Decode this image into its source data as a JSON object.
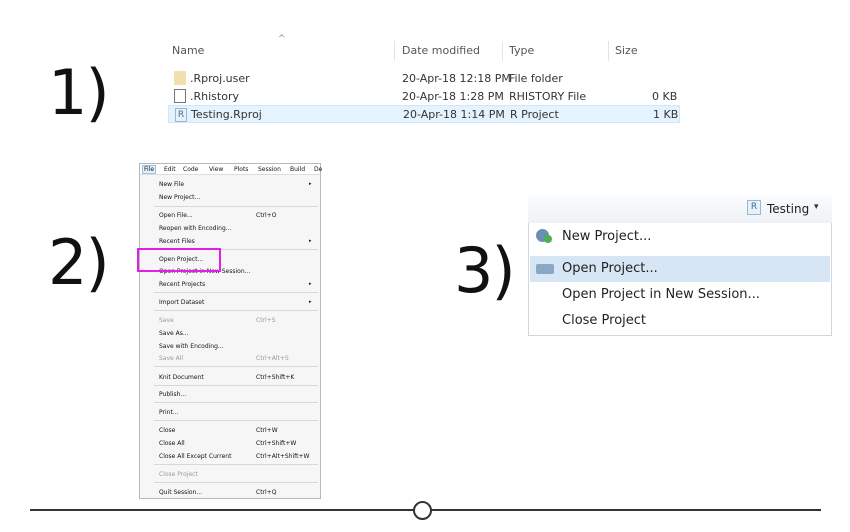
{
  "steps": {
    "one": "1)",
    "two": "2)",
    "three": "3)"
  },
  "explorer": {
    "columns": {
      "name": "Name",
      "date": "Date modified",
      "type": "Type",
      "size": "Size"
    },
    "sort_indicator": "^",
    "rows": [
      {
        "name": ".Rproj.user",
        "date": "20-Apr-18 12:18 PM",
        "type": "File folder",
        "size": "",
        "icon": "folder-icon"
      },
      {
        "name": ".Rhistory",
        "date": "20-Apr-18 1:28 PM",
        "type": "RHISTORY File",
        "size": "0 KB",
        "icon": "document-icon"
      },
      {
        "name": "Testing.Rproj",
        "date": "20-Apr-18 1:14 PM",
        "type": "R Project",
        "size": "1 KB",
        "icon": "rproject-icon"
      }
    ]
  },
  "filemenu": {
    "menubar": [
      "File",
      "Edit",
      "Code",
      "View",
      "Plots",
      "Session",
      "Build",
      "De"
    ],
    "items": {
      "new_file": "New File",
      "new_project": "New Project...",
      "open_file": "Open File...",
      "open_file_sc": "Ctrl+O",
      "reopen": "Reopen with Encoding...",
      "recent_files": "Recent Files",
      "open_project": "Open Project...",
      "open_project_new": "Open Project in New Session...",
      "recent_projects": "Recent Projects",
      "import_dataset": "Import Dataset",
      "save": "Save",
      "save_sc": "Ctrl+S",
      "save_as": "Save As...",
      "save_enc": "Save with Encoding...",
      "save_all": "Save All",
      "save_all_sc": "Ctrl+Alt+S",
      "knit": "Knit Document",
      "knit_sc": "Ctrl+Shift+K",
      "publish": "Publish...",
      "print": "Print...",
      "close": "Close",
      "close_sc": "Ctrl+W",
      "close_all": "Close All",
      "close_all_sc": "Ctrl+Shift+W",
      "close_except": "Close All Except Current",
      "close_except_sc": "Ctrl+Alt+Shift+W",
      "close_project": "Close Project",
      "quit": "Quit Session...",
      "quit_sc": "Ctrl+Q"
    },
    "submenu_arrow": "▸",
    "highlight_color": "#e020e8"
  },
  "projmenu": {
    "project_name": "Testing",
    "caret": "▾",
    "logo_text": "R",
    "items": {
      "new_project": "New Project...",
      "open_project": "Open Project...",
      "open_project_new": "Open Project in New Session...",
      "close_project": "Close Project"
    },
    "highlight_bg": "#d7e6f4"
  }
}
